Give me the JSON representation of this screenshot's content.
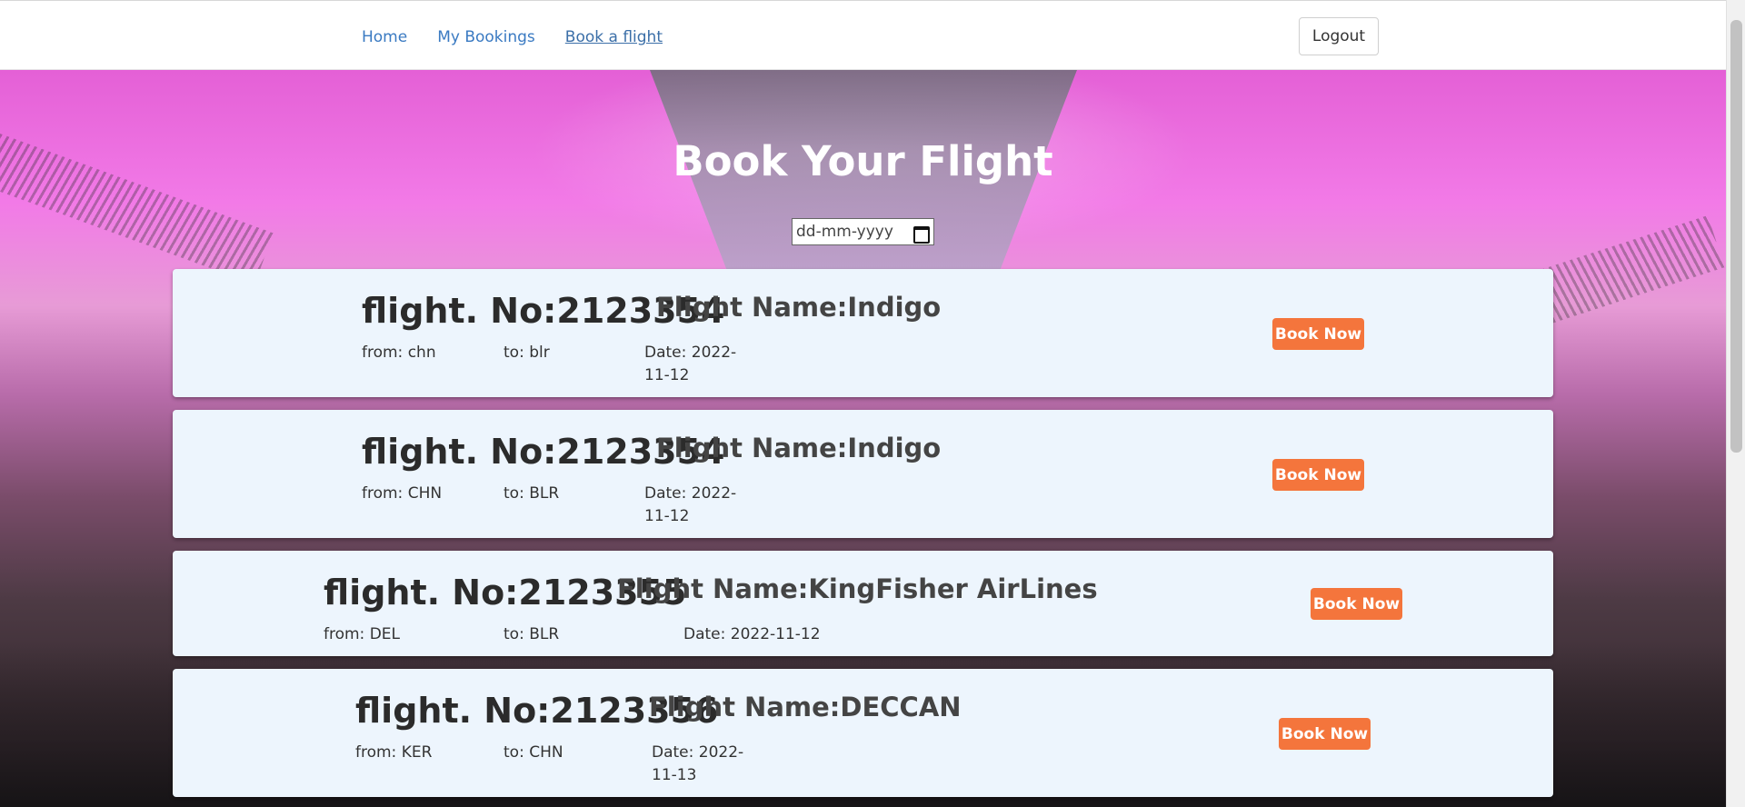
{
  "nav": {
    "items": [
      {
        "label": "Home"
      },
      {
        "label": "My Bookings"
      },
      {
        "label": "Book a flight"
      }
    ],
    "logout_label": "Logout"
  },
  "hero": {
    "title": "Book Your Flight",
    "date_placeholder": "dd-mm-yyyy"
  },
  "flights": [
    {
      "flight_no": "flight. No:2123354",
      "flight_name": "Flight Name:Indigo",
      "from": "from: chn",
      "to": "to: blr",
      "date": "Date: 2022-11-12",
      "button": "Book Now"
    },
    {
      "flight_no": "flight. No:2123354",
      "flight_name": "Flight Name:Indigo",
      "from": "from: CHN",
      "to": "to: BLR",
      "date": "Date: 2022-11-12",
      "button": "Book Now"
    },
    {
      "flight_no": "flight. No:2123355",
      "flight_name": "Flight Name:KingFisher AirLines",
      "from": "from: DEL",
      "to": "to: BLR",
      "date": "Date: 2022-11-12",
      "button": "Book Now"
    },
    {
      "flight_no": "flight. No:2123356",
      "flight_name": "Flight Name:DECCAN",
      "from": "from: KER",
      "to": "to: CHN",
      "date": "Date: 2022-11-13",
      "button": "Book Now"
    }
  ],
  "colors": {
    "link": "#3a7ac2",
    "card_bg": "#edf5fd",
    "book_button": "#f4753c"
  }
}
